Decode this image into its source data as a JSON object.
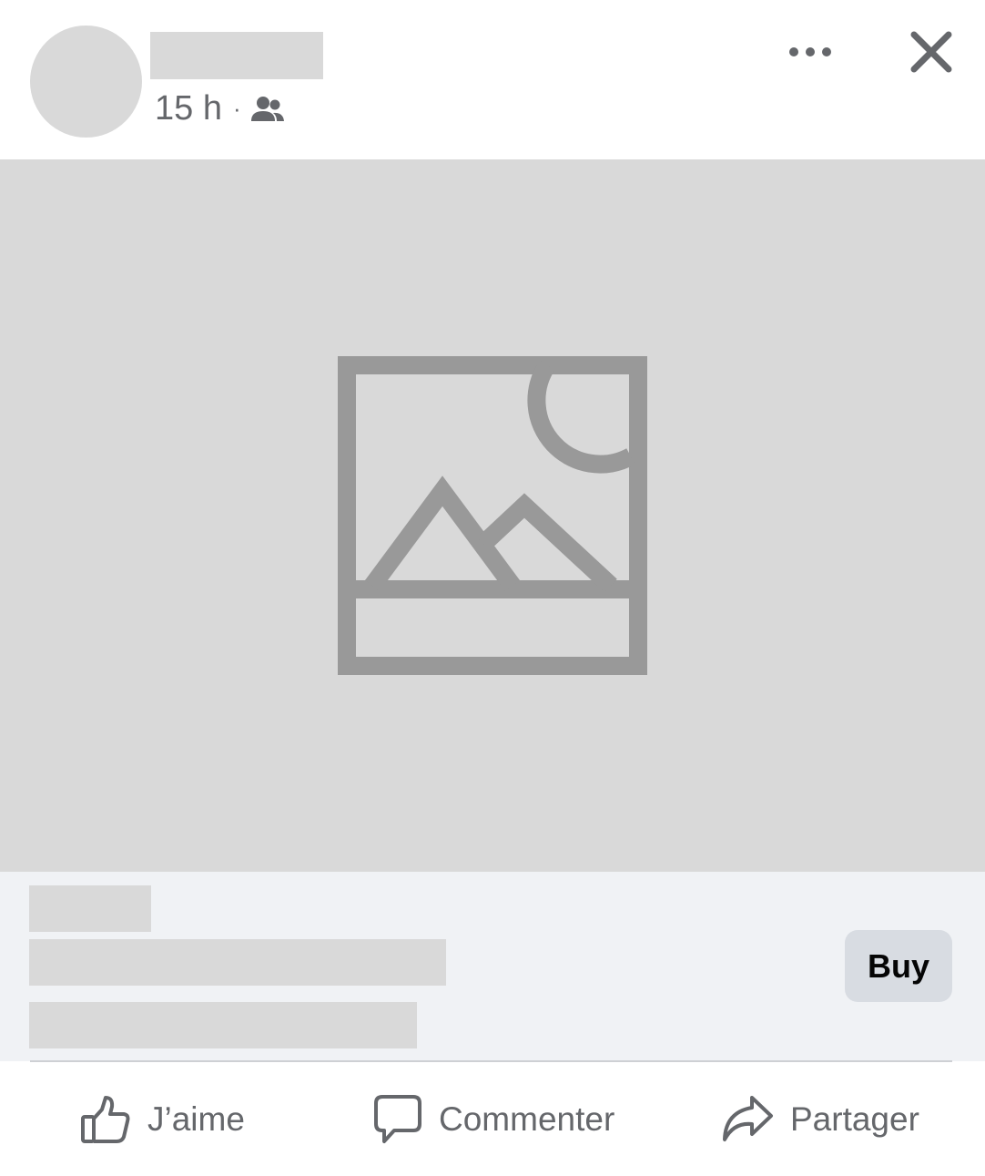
{
  "post": {
    "timestamp": "15 h",
    "separator": "·",
    "audience_icon": "friends-icon",
    "more_icon": "more-horizontal-icon",
    "close_icon": "close-icon"
  },
  "media": {
    "icon": "image-placeholder-icon"
  },
  "cta": {
    "button_label": "Buy"
  },
  "actions": {
    "like_label": "J’aime",
    "comment_label": "Commenter",
    "share_label": "Partager"
  },
  "colors": {
    "placeholder": "#d9d9d9",
    "text_secondary": "#65676b",
    "cta_background": "#f0f2f5",
    "button_background": "#d8dce2"
  }
}
